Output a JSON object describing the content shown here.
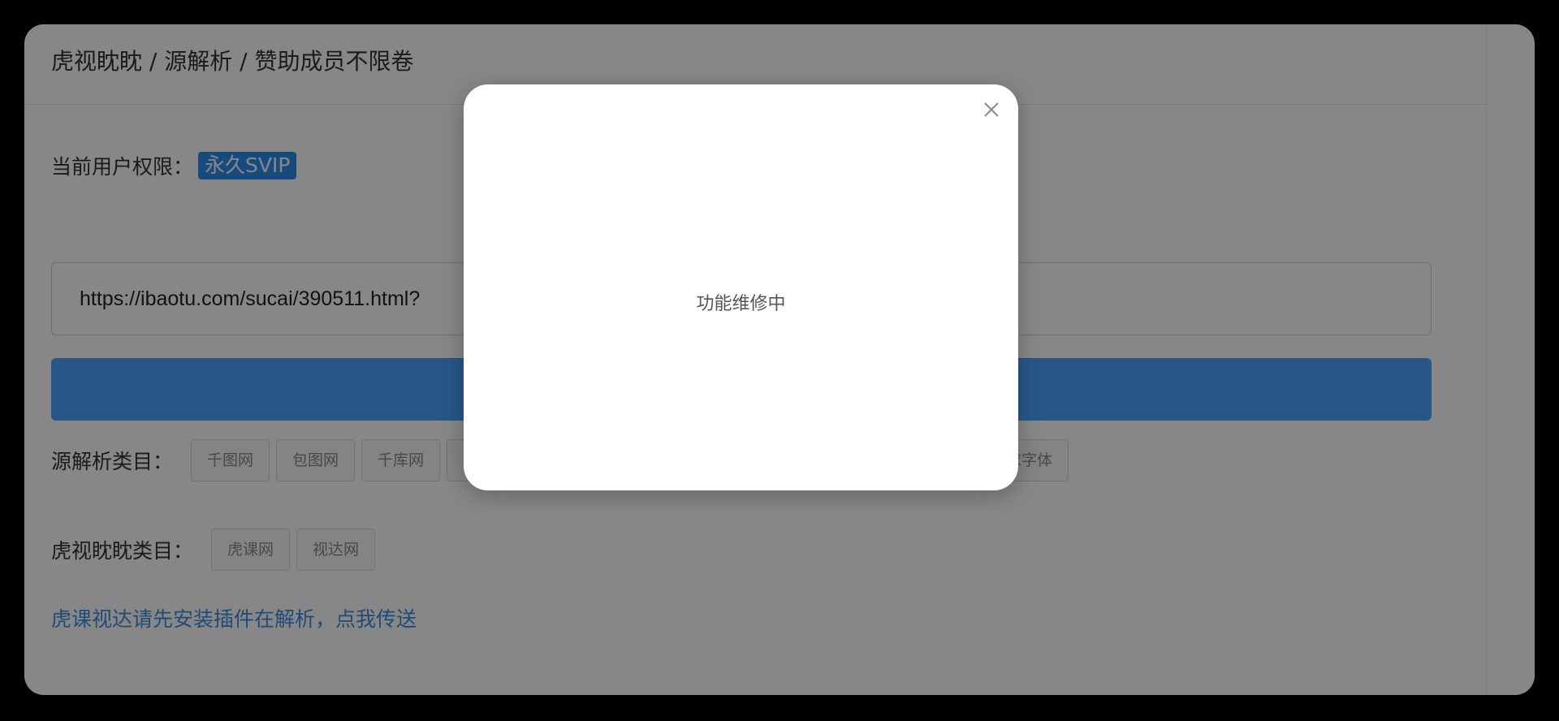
{
  "header": {
    "breadcrumb": "虎视眈眈 / 源解析 / 赞助成员不限卷"
  },
  "permission": {
    "label": "当前用户权限：",
    "badge": "永久SVIP"
  },
  "url_input": {
    "value": "https://ibaotu.com/sucai/390511.html?"
  },
  "source_categories": {
    "label": "源解析类目：",
    "tags": [
      "千图网",
      "包图网",
      "千库网",
      "",
      "",
      "",
      "",
      "",
      "",
      "求字体"
    ]
  },
  "tiger_categories": {
    "label": "虎视眈眈类目：",
    "tags": [
      "虎课网",
      "视达网"
    ]
  },
  "plugin_link": {
    "text": "虎课视达请先安装插件在解析，点我传送"
  },
  "modal": {
    "message": "功能维修中"
  },
  "colors": {
    "primary": "#2d8cf0",
    "button": "#4aa4ff",
    "link": "#3b8fe0"
  }
}
